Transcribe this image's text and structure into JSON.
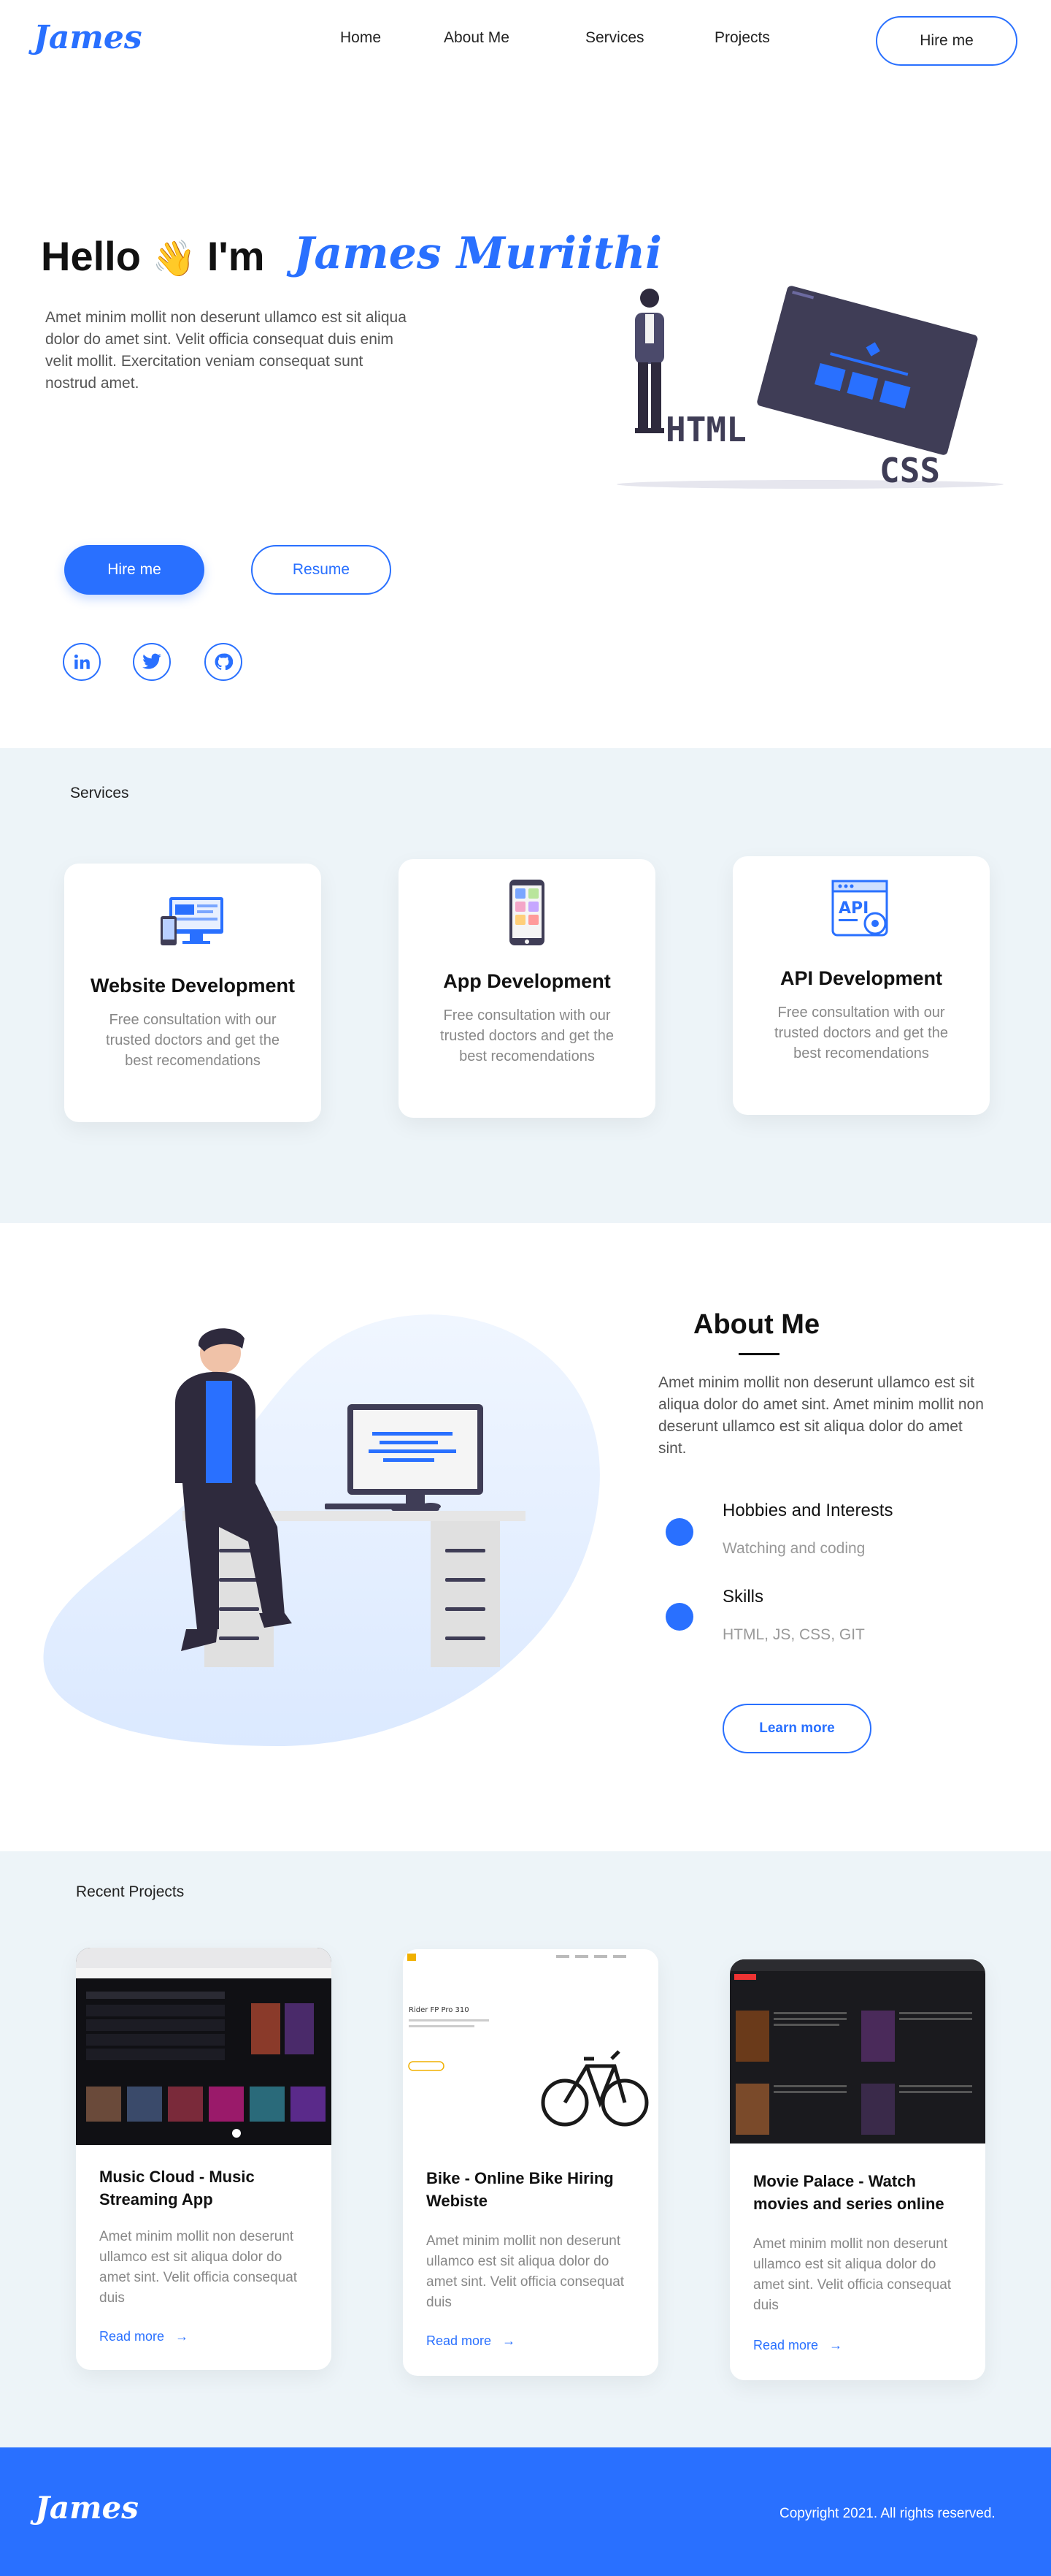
{
  "nav": {
    "logo": "James",
    "links": [
      "Home",
      "About Me",
      "Services",
      "Projects"
    ],
    "hire_label": "Hire me"
  },
  "hero": {
    "greeting": "Hello",
    "wave_emoji": "👋",
    "im": "I'm",
    "name": "James Muriithi",
    "text": "Amet minim mollit non deserunt ullamco est sit aliqua dolor do amet sint. Velit officia consequat duis enim velit mollit. Exercitation veniam consequat sunt nostrud amet.",
    "hire_label": "Hire me",
    "resume_label": "Resume",
    "illustration_words": [
      "HTML",
      "CSS"
    ],
    "socials": [
      "linkedin-icon",
      "twitter-icon",
      "github-icon"
    ]
  },
  "services": {
    "label": "Services",
    "cards": [
      {
        "title": "Website Development",
        "text": "Free consultation with our trusted doctors and get the best recomendations",
        "icon": "website-icon"
      },
      {
        "title": "App Development",
        "text": "Free consultation with our trusted doctors and get the best recomendations",
        "icon": "phone-app-icon"
      },
      {
        "title": "API Development",
        "text": "Free consultation with our trusted doctors and get the best recomendations",
        "icon": "api-icon"
      }
    ]
  },
  "about": {
    "title": "About Me",
    "text": "Amet minim mollit non deserunt ullamco est sit aliqua dolor do amet sint. Amet minim mollit non deserunt ullamco est sit aliqua dolor do amet sint.",
    "items": [
      {
        "title": "Hobbies and Interests",
        "value": "Watching and coding"
      },
      {
        "title": "Skills",
        "value": "HTML, JS, CSS, GIT"
      }
    ],
    "learn_more_label": "Learn more"
  },
  "projects": {
    "label": "Recent Projects",
    "cards": [
      {
        "title": "Music Cloud - Music Streaming App",
        "text": "Amet minim mollit non deserunt ullamco est sit aliqua dolor do amet sint. Velit officia consequat duis",
        "link": "Read more"
      },
      {
        "title": "Bike - Online Bike Hiring Webiste",
        "text": "Amet minim mollit non deserunt ullamco est sit aliqua dolor do amet sint. Velit officia consequat duis",
        "link": "Read more"
      },
      {
        "title": "Movie Palace - Watch movies and series online",
        "text": "Amet minim mollit non deserunt ullamco est sit aliqua dolor do amet sint. Velit officia consequat duis",
        "link": "Read more"
      }
    ],
    "bike_screenshot_title": "Rider FP Pro 310"
  },
  "footer": {
    "logo": "James",
    "copyright": "Copyright 2021. All rights reserved."
  },
  "colors": {
    "accent": "#2970ff",
    "band": "#edf4f8"
  }
}
